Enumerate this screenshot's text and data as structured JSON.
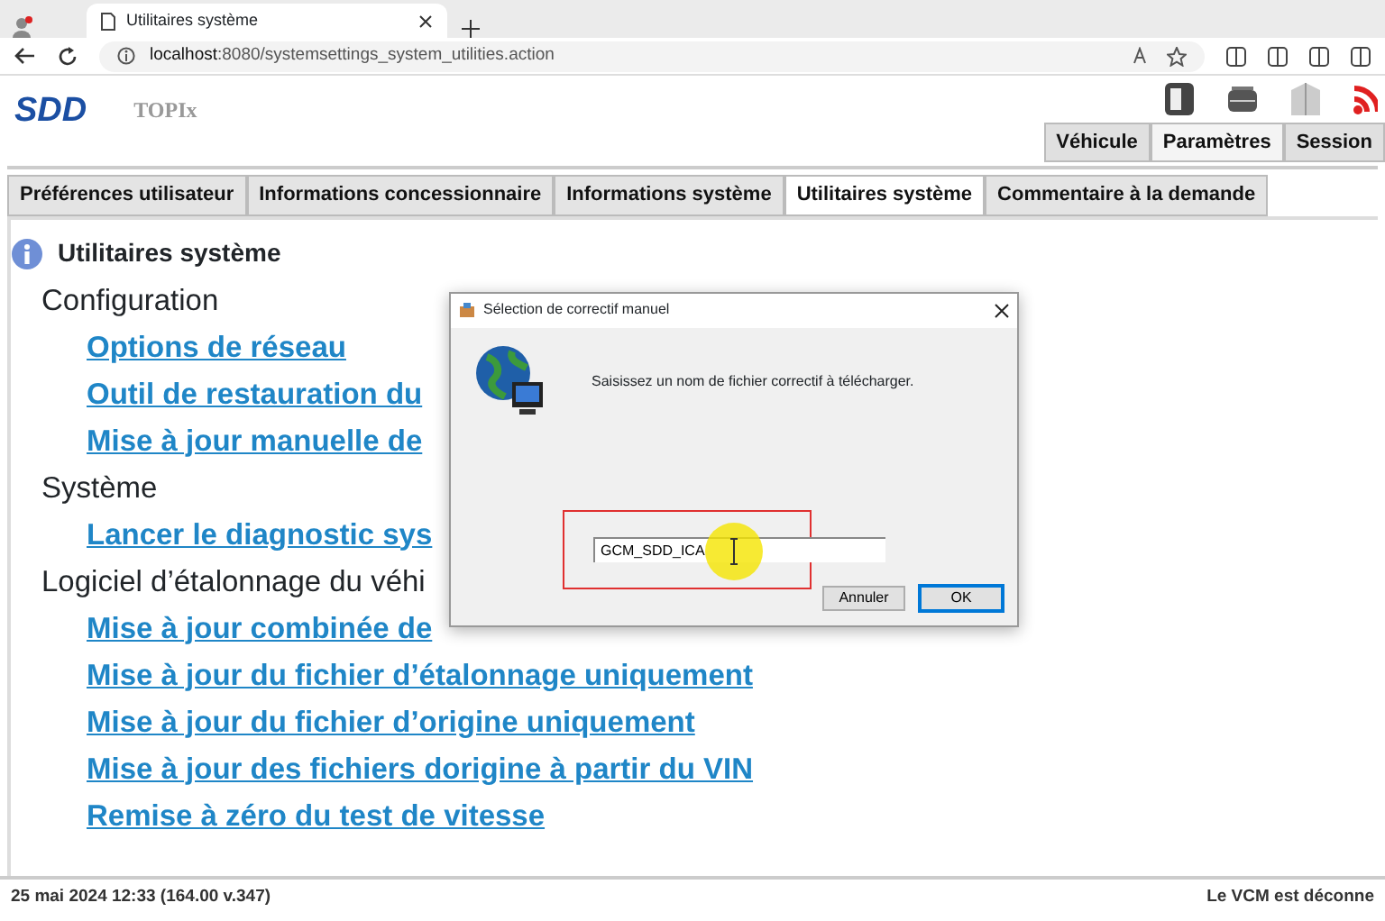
{
  "browser": {
    "tab_title": "Utilitaires système",
    "url_host": "localhost",
    "url_rest": ":8080/systemsettings_system_utilities.action"
  },
  "app": {
    "logo": "SDD",
    "product": "TOPIx"
  },
  "nav_tabs": [
    {
      "label": "Véhicule",
      "selected": false
    },
    {
      "label": "Paramètres",
      "selected": true
    },
    {
      "label": "Session",
      "selected": false
    }
  ],
  "sub_tabs": [
    {
      "label": "Préférences utilisateur",
      "selected": false
    },
    {
      "label": "Informations concessionnaire",
      "selected": false
    },
    {
      "label": "Informations système",
      "selected": false
    },
    {
      "label": "Utilitaires système",
      "selected": true
    },
    {
      "label": "Commentaire à la demande",
      "selected": false
    }
  ],
  "heading": "Utilitaires système",
  "sections": [
    {
      "title": "Configuration",
      "links": [
        "Options de réseau",
        "Outil de restauration du",
        "Mise à jour manuelle de"
      ]
    },
    {
      "title": "Système",
      "links": [
        "Lancer le diagnostic sys"
      ]
    },
    {
      "title": "Logiciel d’étalonnage du véhi",
      "links": [
        "Mise à jour combinée de",
        "Mise à jour du fichier d’étalonnage uniquement",
        "Mise à jour du fichier d’origine uniquement",
        "Mise à jour des fichiers dorigine à partir du VIN",
        "Remise à zéro du test de vitesse"
      ]
    }
  ],
  "status_bar": {
    "left": "25 mai 2024 12:33 (164.00 v.347)",
    "right": "Le VCM est déconne"
  },
  "dialog": {
    "title": "Sélection de correctif manuel",
    "message": "Saisissez un nom de fichier correctif à télécharger.",
    "value": "GCM_SDD_ICA",
    "buttons": [
      {
        "label": "Annuler",
        "default": false
      },
      {
        "label": "OK",
        "default": true
      }
    ]
  }
}
